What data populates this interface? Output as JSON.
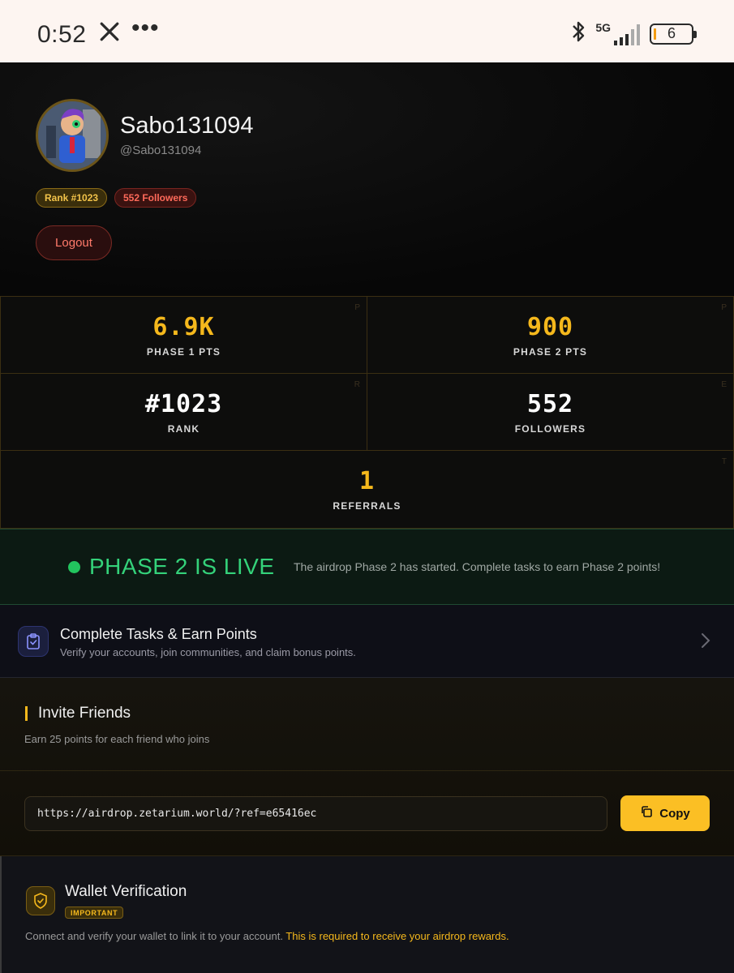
{
  "status_bar": {
    "time": "0:52",
    "dots": "•••",
    "network": "5G",
    "battery": "6"
  },
  "profile": {
    "display_name": "Sabo131094",
    "handle": "@Sabo131094",
    "rank_badge": "Rank #1023",
    "followers_badge": "552 Followers",
    "logout_label": "Logout"
  },
  "stats": {
    "phase1": {
      "value": "6.9K",
      "label": "PHASE 1 PTS"
    },
    "phase2": {
      "value": "900",
      "label": "PHASE 2 PTS"
    },
    "rank": {
      "value": "#1023",
      "label": "RANK"
    },
    "followers": {
      "value": "552",
      "label": "FOLLOWERS"
    },
    "referrals": {
      "value": "1",
      "label": "REFERRALS"
    }
  },
  "phase_banner": {
    "title": "PHASE 2 IS LIVE",
    "description": "The airdrop Phase 2 has started. Complete tasks to earn Phase 2 points!"
  },
  "tasks": {
    "title": "Complete Tasks & Earn Points",
    "subtitle": "Verify your accounts, join communities, and claim bonus points."
  },
  "invite": {
    "title": "Invite Friends",
    "subtitle": "Earn 25 points for each friend who joins",
    "referral_link": "https://airdrop.zetarium.world/?ref=e65416ec",
    "copy_label": "Copy"
  },
  "wallet": {
    "title": "Wallet Verification",
    "tag": "IMPORTANT",
    "description": "Connect and verify your wallet to link it to your account.",
    "highlight": "This is required to receive your airdrop rewards."
  },
  "colors": {
    "accent_gold": "#f5b81c",
    "live_green": "#34d27a",
    "danger_red": "#ff6a5a"
  }
}
